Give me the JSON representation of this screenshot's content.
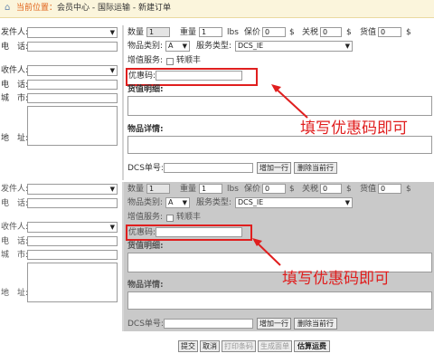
{
  "breadcrumb": {
    "label": "当前位置：",
    "path": "会员中心 - 国际运输 - 新建订单"
  },
  "icons": {
    "home": "home-icon",
    "dropdown": "chevron-down-icon",
    "arrow": "arrow-icon"
  },
  "colors": {
    "annotation": "#e01e1e",
    "section_bg": "#c9c9c9",
    "crumb_bg": "#fbf5dc",
    "crumb_current": "#e1641a"
  },
  "left": {
    "sender_label": "发件人:",
    "phone_label": "电　话:",
    "recipient_label": "收件人:",
    "phone2_label": "电　话:",
    "city_label": "城　市:",
    "address_label": "地　址:"
  },
  "form": {
    "qty_label": "数量",
    "qty_value": "1",
    "weight_label": "重量",
    "weight_value": "1",
    "weight_unit": "lbs",
    "insured_label": "保价",
    "insured_value": "0",
    "currency": "$",
    "tax_label": "关税",
    "tax_value": "0",
    "goods_value_label": "货值",
    "goods_value_value": "0",
    "category_label": "物品类别:",
    "category_value": "A",
    "service_type_label": "服务类型:",
    "service_type_value": "DCS_IE",
    "value_added_label": "增值服务:",
    "value_added_option": "转顺丰",
    "coupon_label": "优惠码:",
    "goods_detail_label": "货值明细:",
    "item_detail_label": "物品详情:",
    "dcs_label": "DCS单号:",
    "add_row_button": "增加一行",
    "delete_row_button": "删除当前行"
  },
  "annotation": {
    "text": "填写优惠码即可"
  },
  "actions": {
    "submit": "提交",
    "cancel": "取消",
    "print_barcode": "打印条码",
    "generate_form": "生成面单",
    "estimate_freight": "估算运费"
  }
}
